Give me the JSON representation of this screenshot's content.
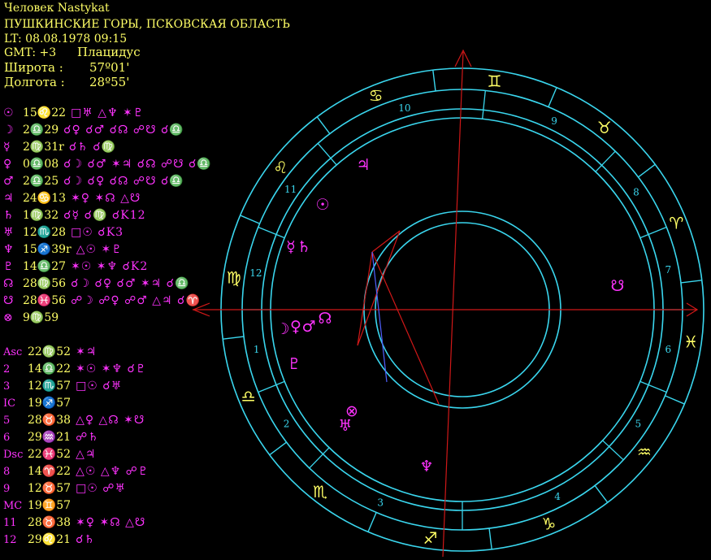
{
  "header": {
    "name": "Человек Nastykat",
    "place": "ПУШКИНСКИЕ ГОРЫ, ПСКОВСКАЯ ОБЛАСТЬ",
    "lt": "LT: 08.08.1978  09:15",
    "gmt": "GMT: +3",
    "system": "Плацидус",
    "lat_label": "Широта :",
    "lat_value": "57º01'",
    "lon_label": "Долгота :",
    "lon_value": "28º55'"
  },
  "planets": [
    {
      "symbol": "☉",
      "pos": "15♌22",
      "aspects": "□♅ △♆ ✶♇"
    },
    {
      "symbol": "☽",
      "pos": "2♎29",
      "aspects": "☌♀ ☌♂ ☌☊ ☍☋ ☌♎"
    },
    {
      "symbol": "☿",
      "pos": "2♍31r",
      "aspects": "☌♄ ☌♍"
    },
    {
      "symbol": "♀",
      "pos": "0♎08",
      "aspects": "☌☽ ☌♂ ✶♃ ☌☊ ☍☋ ☌♎"
    },
    {
      "symbol": "♂",
      "pos": "2♎25",
      "aspects": "☌☽ ☌♀ ☌☊ ☍☋ ☌♎"
    },
    {
      "symbol": "♃",
      "pos": "24♋13",
      "aspects": "✶♀ ✶☊ △☋"
    },
    {
      "symbol": "♄",
      "pos": "1♍32",
      "aspects": "☌☿ ☌♍ ☌K12"
    },
    {
      "symbol": "♅",
      "pos": "12♏28",
      "aspects": "□☉ ☌K3"
    },
    {
      "symbol": "♆",
      "pos": "15♐39r",
      "aspects": "△☉ ✶♇"
    },
    {
      "symbol": "♇",
      "pos": "14♎27",
      "aspects": "✶☉ ✶♆ ☌K2"
    },
    {
      "symbol": "☊",
      "pos": "28♍56",
      "aspects": "☌☽ ☌♀ ☌♂ ✶♃ ☌♎"
    },
    {
      "symbol": "☋",
      "pos": "28♓56",
      "aspects": "☍☽ ☍♀ ☍♂ △♃ ☌♈"
    },
    {
      "symbol": "⊗",
      "pos": "9♍59",
      "aspects": ""
    }
  ],
  "houses": [
    {
      "label": "Asc",
      "pos": "22♍52",
      "aspects": "✶♃"
    },
    {
      "label": "2",
      "pos": "14♎22",
      "aspects": "✶☉ ✶♆ ☌♇"
    },
    {
      "label": "3",
      "pos": "12♏57",
      "aspects": "□☉ ☌♅"
    },
    {
      "label": "IC",
      "pos": "19♐57",
      "aspects": ""
    },
    {
      "label": "5",
      "pos": "28♉38",
      "aspects": "△♀ △☊ ✶☋"
    },
    {
      "label": "6",
      "pos": "29♒21",
      "aspects": "☍♄"
    },
    {
      "label": "Dsc",
      "pos": "22♓52",
      "aspects": "△♃"
    },
    {
      "label": "8",
      "pos": "14♈22",
      "aspects": "△☉ △♆ ☍♇"
    },
    {
      "label": "9",
      "pos": "12♉57",
      "aspects": "□☉ ☍♅"
    },
    {
      "label": "MC",
      "pos": "19♊57",
      "aspects": ""
    },
    {
      "label": "11",
      "pos": "28♉38",
      "aspects": "✶♀ ✶☊ △☋"
    },
    {
      "label": "12",
      "pos": "29♌21",
      "aspects": "☌♄"
    }
  ],
  "wheel": {
    "zodiac_signs": [
      "♍",
      "♌",
      "♋",
      "♊",
      "♉",
      "♈",
      "♓",
      "♒",
      "♑",
      "♐",
      "♏",
      "♎"
    ],
    "house_numbers": [
      "1",
      "2",
      "3",
      "4",
      "5",
      "6",
      "7",
      "8",
      "9",
      "10",
      "11",
      "12"
    ],
    "wheel_planets": [
      "☉",
      "☽",
      "☿",
      "♀",
      "♂",
      "♃",
      "♄",
      "♅",
      "♆",
      "♇",
      "☊",
      "☋",
      "⊗"
    ],
    "colors": {
      "ring": "#3ad6ee",
      "axis": "#d01818",
      "glyph": "#ff33ff",
      "text": "#ffff66",
      "blue_aspect": "#5060ff"
    }
  }
}
